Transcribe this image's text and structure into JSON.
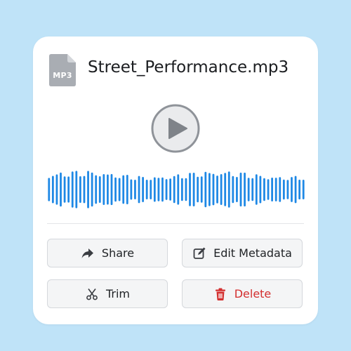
{
  "file": {
    "name": "Street_Performance.mp3",
    "extension": "MP3"
  },
  "player": {
    "play_icon": "play-icon",
    "waveform_color": "#1e88e5"
  },
  "actions": {
    "share": {
      "label": "Share",
      "icon": "share-icon"
    },
    "edit_metadata": {
      "label": "Edit Metadata",
      "icon": "edit-icon"
    },
    "trim": {
      "label": "Trim",
      "icon": "scissors-icon"
    },
    "delete": {
      "label": "Delete",
      "icon": "trash-icon",
      "color": "#d32f2f"
    }
  },
  "colors": {
    "background": "#bfe3f8",
    "card": "#ffffff",
    "accent": "#1e88e5",
    "danger": "#d32f2f"
  }
}
